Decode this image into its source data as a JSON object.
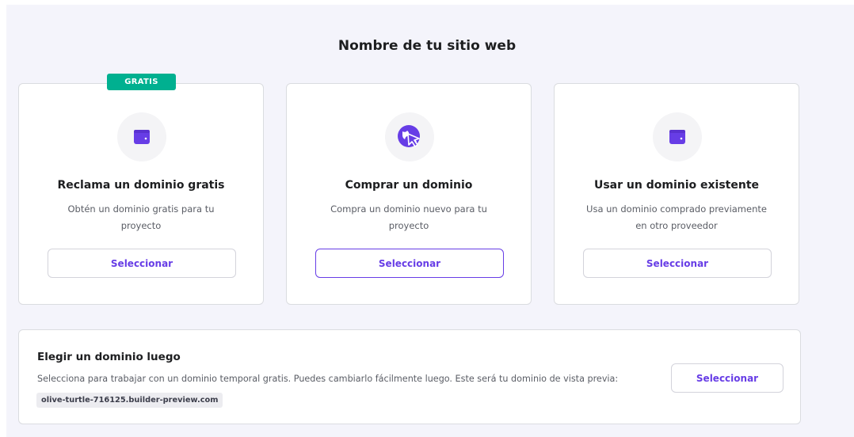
{
  "page": {
    "title": "Nombre de tu sitio web"
  },
  "badge": "GRATIS",
  "cards": [
    {
      "icon": "wallet-icon",
      "title": "Reclama un dominio gratis",
      "description": "Obtén un dominio gratis para tu proyecto",
      "button": "Seleccionar"
    },
    {
      "icon": "globe-cursor-icon",
      "title": "Comprar un dominio",
      "description": "Compra un dominio nuevo para tu proyecto",
      "button": "Seleccionar"
    },
    {
      "icon": "wallet-icon",
      "title": "Usar un dominio existente",
      "description": "Usa un dominio comprado previamente en otro proveedor",
      "button": "Seleccionar"
    }
  ],
  "later": {
    "title": "Elegir un dominio luego",
    "description": "Selecciona para trabajar con un dominio temporal gratis. Puedes cambiarlo fácilmente luego. Este será tu dominio de vista previa:",
    "preview_domain": "olive-turtle-716125.builder-preview.com",
    "button": "Seleccionar"
  },
  "colors": {
    "accent": "#673de6",
    "badge": "#00b090",
    "panel_bg": "#f4f4fb"
  }
}
